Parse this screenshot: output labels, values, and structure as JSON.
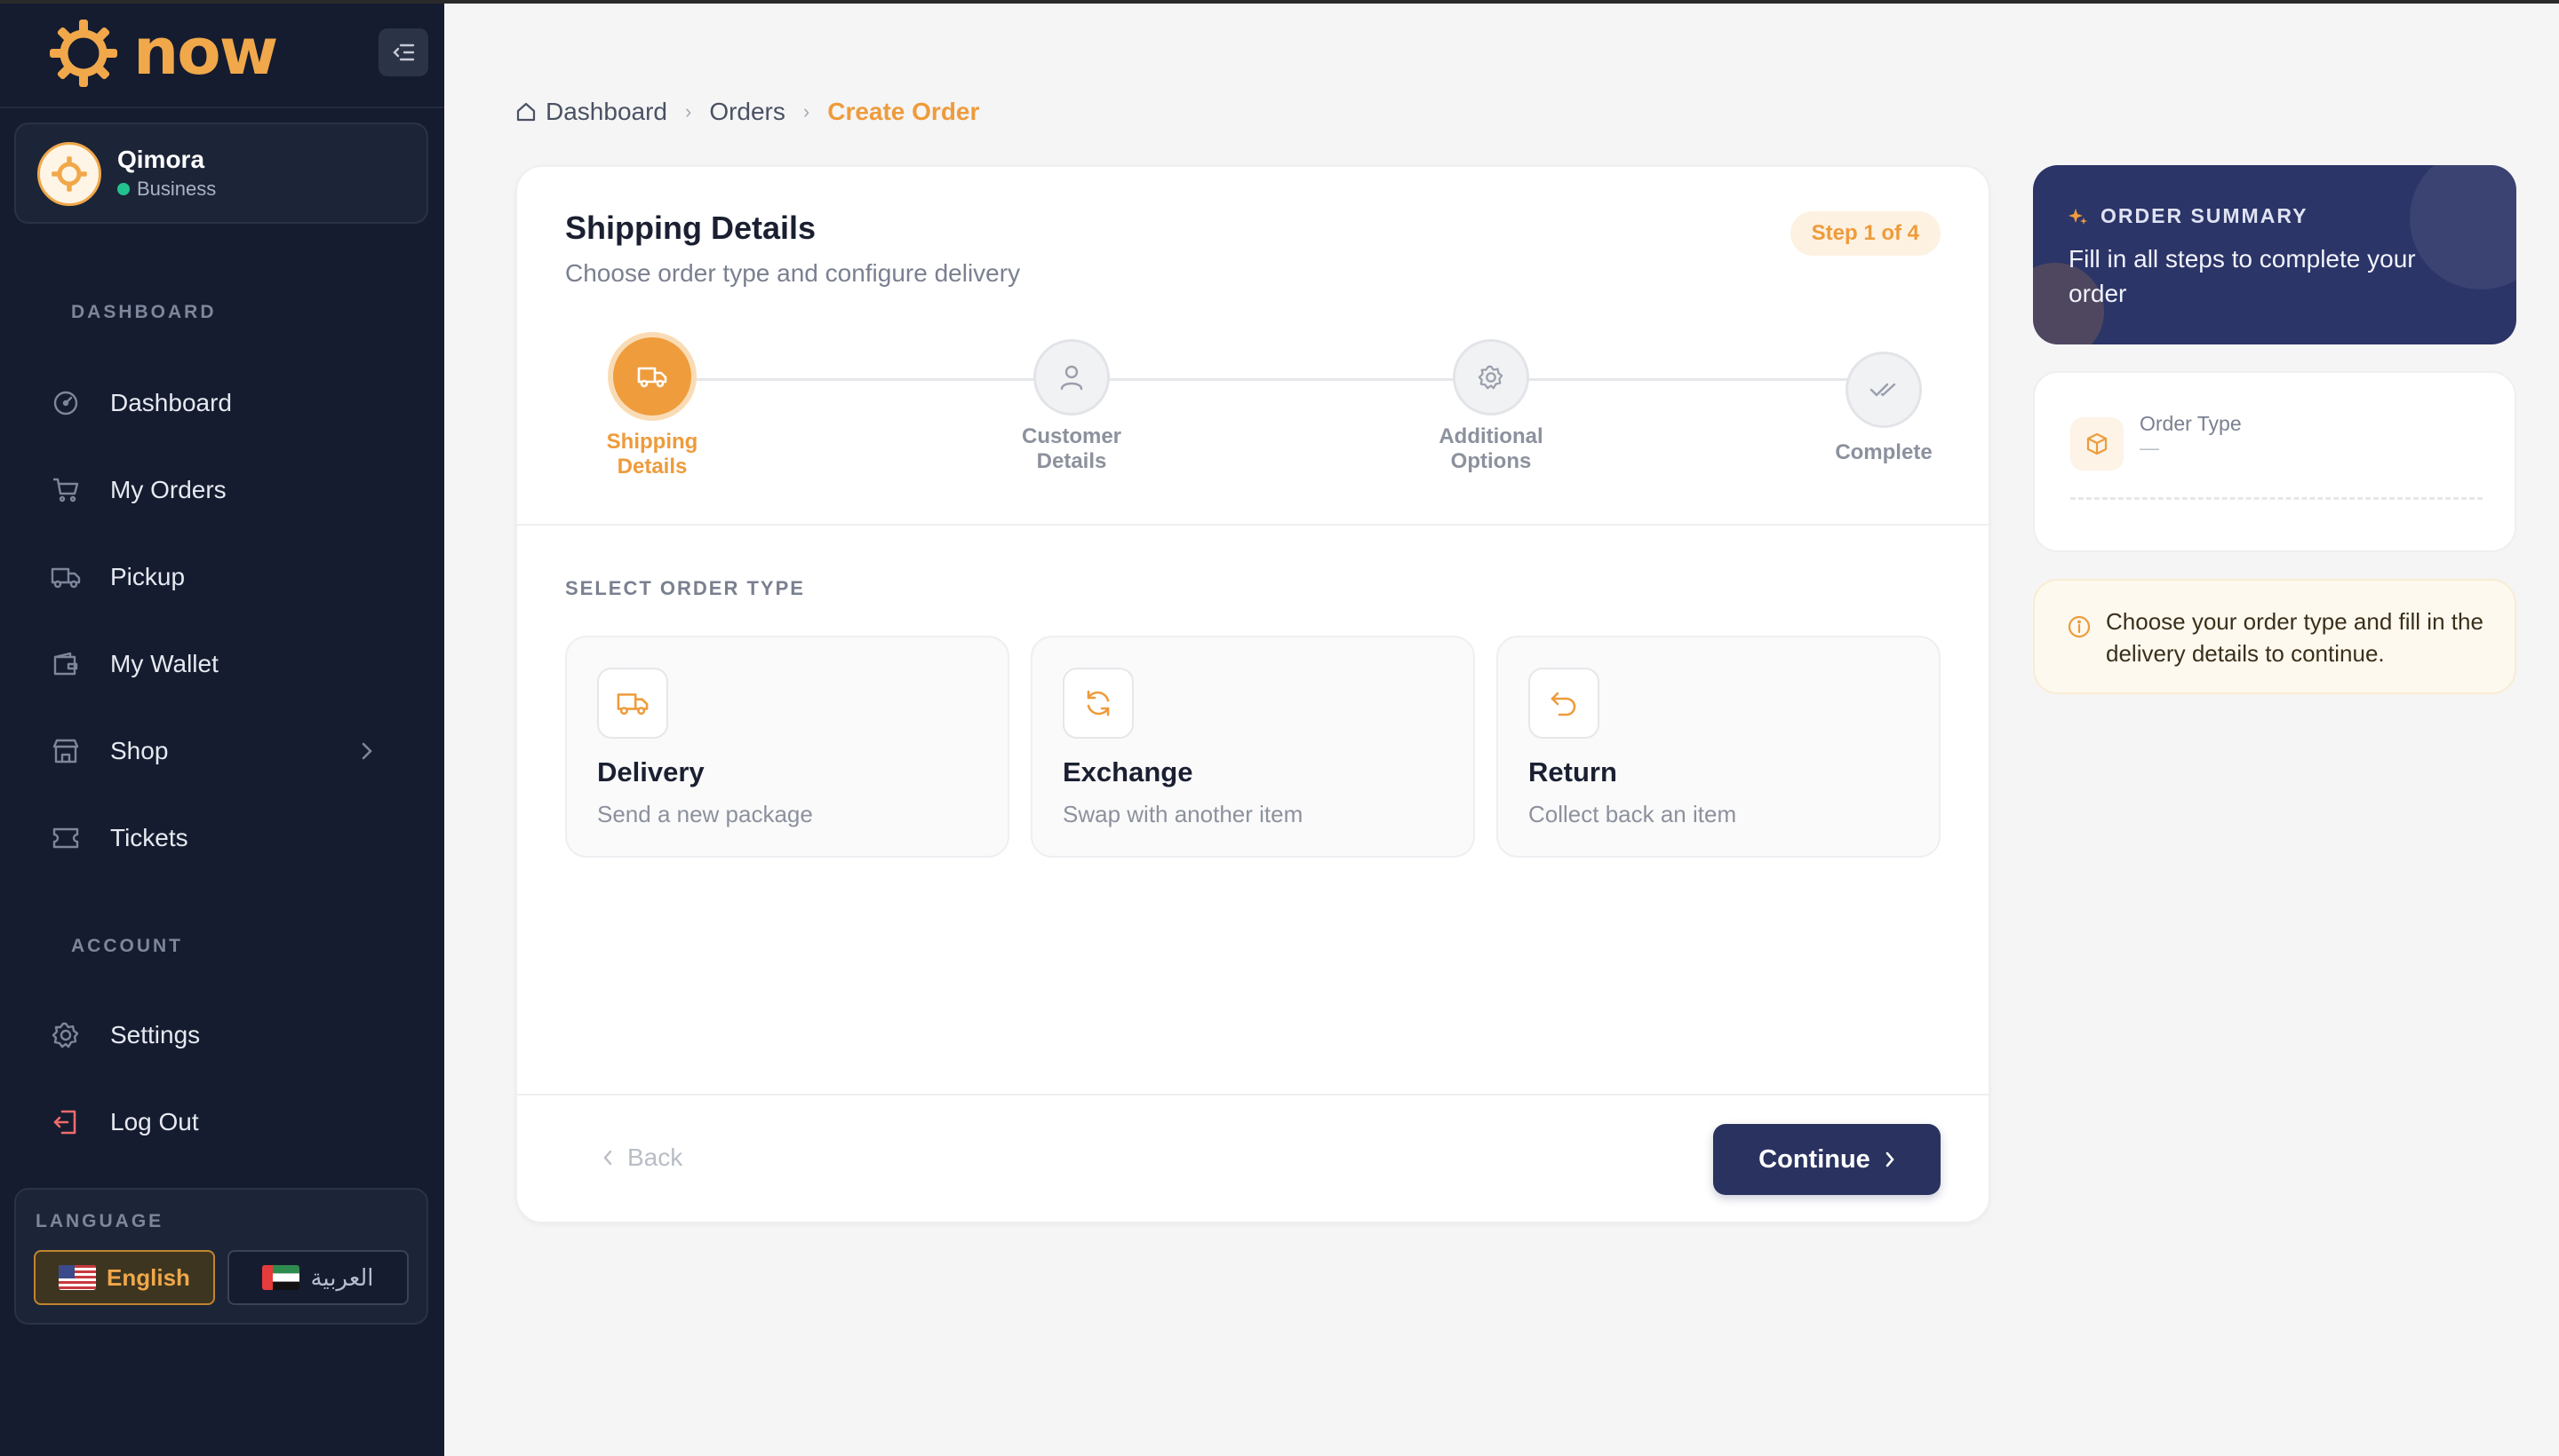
{
  "brand": {
    "name": "now",
    "accent": "#f0a84a"
  },
  "user": {
    "name": "Qimora",
    "role": "Business"
  },
  "sidebar": {
    "section_dashboard": "DASHBOARD",
    "section_account": "ACCOUNT",
    "items": [
      {
        "label": "Dashboard",
        "icon": "gauge-icon"
      },
      {
        "label": "My Orders",
        "icon": "cart-icon"
      },
      {
        "label": "Pickup",
        "icon": "truck-icon"
      },
      {
        "label": "My Wallet",
        "icon": "wallet-icon"
      },
      {
        "label": "Shop",
        "icon": "store-icon"
      },
      {
        "label": "Tickets",
        "icon": "ticket-icon"
      }
    ],
    "account_items": [
      {
        "label": "Settings",
        "icon": "gear-icon"
      },
      {
        "label": "Log Out",
        "icon": "logout-icon"
      }
    ],
    "language": {
      "title": "LANGUAGE",
      "english": "English",
      "arabic": "العربية"
    }
  },
  "breadcrumb": {
    "home": "Dashboard",
    "orders": "Orders",
    "current": "Create Order"
  },
  "wizard": {
    "title": "Shipping Details",
    "subtitle": "Choose order type and configure delivery",
    "step_badge": "Step 1 of 4",
    "steps": [
      {
        "line1": "Shipping",
        "line2": "Details",
        "icon": "truck-icon",
        "active": true
      },
      {
        "line1": "Customer",
        "line2": "Details",
        "icon": "user-icon",
        "active": false
      },
      {
        "line1": "Additional",
        "line2": "Options",
        "icon": "gear-icon",
        "active": false
      },
      {
        "line1": "Complete",
        "line2": "",
        "icon": "double-check-icon",
        "active": false
      }
    ],
    "select_label": "SELECT ORDER TYPE",
    "order_types": [
      {
        "title": "Delivery",
        "desc": "Send a new package",
        "icon": "truck-icon"
      },
      {
        "title": "Exchange",
        "desc": "Swap with another item",
        "icon": "refresh-icon"
      },
      {
        "title": "Return",
        "desc": "Collect back an item",
        "icon": "undo-icon"
      }
    ],
    "back_label": "Back",
    "continue_label": "Continue"
  },
  "summary": {
    "title": "ORDER SUMMARY",
    "text": "Fill in all steps to complete your order",
    "order_type_label": "Order Type",
    "order_type_value": "—",
    "notice": "Choose your order type and fill in the delivery details to continue."
  },
  "colors": {
    "sidebar_bg": "#151c2f",
    "accent": "#ee9b3b",
    "primary": "#2a3260"
  }
}
